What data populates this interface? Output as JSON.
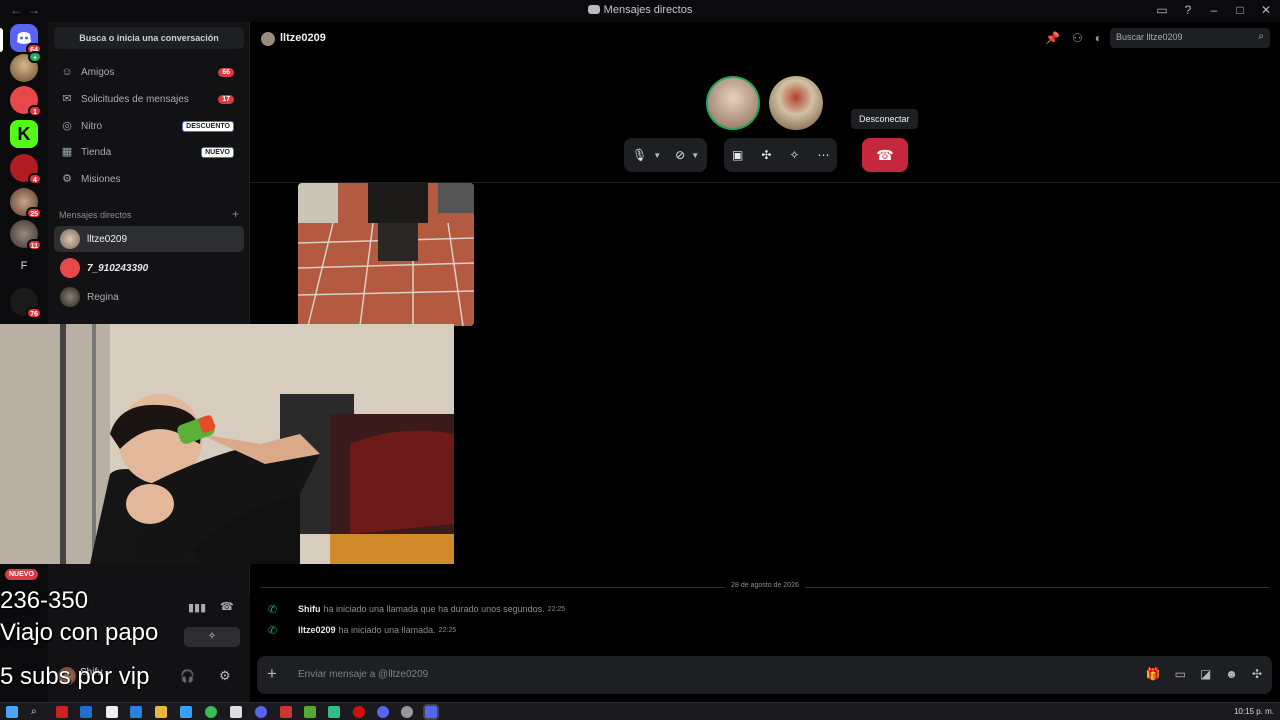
{
  "window": {
    "title": "Mensajes directos"
  },
  "server_rail": {
    "badges": [
      "64",
      "1",
      "4",
      "25",
      "11",
      "76"
    ],
    "folder_letter": "F"
  },
  "sidebar": {
    "search_label": "Busca o inicia una conversación",
    "nav": [
      {
        "label": "Amigos",
        "icon": "friends-icon",
        "count": "66"
      },
      {
        "label": "Solicitudes de mensajes",
        "icon": "mail-icon",
        "count": "17"
      },
      {
        "label": "Nitro",
        "icon": "nitro-icon",
        "tag": "DESCUENTO"
      },
      {
        "label": "Tienda",
        "icon": "shop-icon",
        "tag": "NUEVO"
      },
      {
        "label": "Misiones",
        "icon": "quest-icon"
      }
    ],
    "dm_header": "Mensajes directos",
    "dms": [
      {
        "name": "lltze0209",
        "active": true
      },
      {
        "name": "7_910243390"
      },
      {
        "name": "Regina"
      }
    ]
  },
  "header": {
    "channel_name": "lltze0209",
    "search_placeholder": "Buscar lltze0209"
  },
  "call": {
    "tooltip": "Desconectar"
  },
  "chat": {
    "date_separator": "28 de agosto de 2026",
    "messages": [
      {
        "user": "Shifu",
        "text": "ha iniciado una llamada que ha durado unos segundos.",
        "time": "22:25"
      },
      {
        "user": "lltze0209",
        "text": "ha iniciado una llamada.",
        "time": "22:25"
      }
    ],
    "composer_placeholder": "Enviar mensaje a @lltze0209"
  },
  "user_panel": {
    "username": "Shifu",
    "new_badge": "NUEVO"
  },
  "overlay": {
    "line1": "236-350",
    "line2": "Viajo con papo",
    "line3": "5 subs por vip"
  },
  "taskbar": {
    "clock": "10:15 p. m."
  },
  "colors": {
    "accent_red": "#c7273d",
    "blurple": "#5865f2",
    "online_green": "#23a55a"
  }
}
